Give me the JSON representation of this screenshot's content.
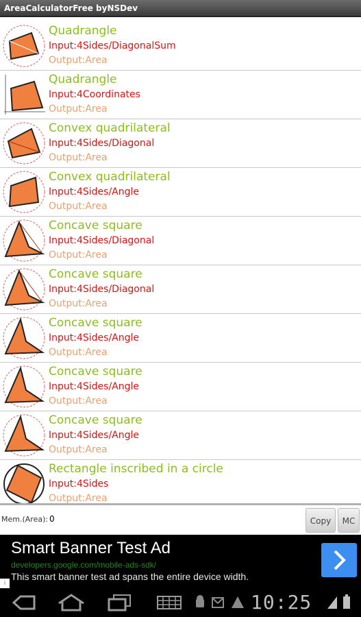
{
  "app": {
    "title": "AreaCalculatorFree byNSDev"
  },
  "items": [
    {
      "title": "Quadrangle",
      "input": "Input:4Sides/DiagonalSum",
      "output": "Output:Area",
      "icon": "quad-circle-icon"
    },
    {
      "title": "Quadrangle",
      "input": "Input:4Coordinates",
      "output": "Output:Area",
      "icon": "quad-coordinates-icon"
    },
    {
      "title": "Convex quadrilateral",
      "input": "Input:4Sides/Diagonal",
      "output": "Output:Area",
      "icon": "convex-diagonal-icon"
    },
    {
      "title": "Convex quadrilateral",
      "input": "Input:4Sides/Angle",
      "output": "Output:Area",
      "icon": "convex-angle-icon"
    },
    {
      "title": "Concave square",
      "input": "Input:4Sides/Diagonal",
      "output": "Output:Area",
      "icon": "concave-diagonal-icon"
    },
    {
      "title": "Concave square",
      "input": "Input:4Sides/Diagonal",
      "output": "Output:Area",
      "icon": "concave-diagonal-icon"
    },
    {
      "title": "Concave square",
      "input": "Input:4Sides/Angle",
      "output": "Output:Area",
      "icon": "concave-angle-icon"
    },
    {
      "title": "Concave square",
      "input": "Input:4Sides/Angle",
      "output": "Output:Area",
      "icon": "concave-angle-icon"
    },
    {
      "title": "Concave square",
      "input": "Input:4Sides/Angle",
      "output": "Output:Area",
      "icon": "concave-angle-icon"
    },
    {
      "title": "Rectangle inscribed in a circle",
      "input": "Input:4Sides",
      "output": "Output:Area",
      "icon": "inscribed-rectangle-icon"
    }
  ],
  "memory": {
    "label": "Mem.(Area):",
    "value": "0",
    "copy_label": "Copy",
    "mc_label": "MC"
  },
  "ad": {
    "title": "Smart Banner Test Ad",
    "url": "developers.google.com/mobile-ads-sdk/",
    "description": "This smart banner test ad spans the entire device width.",
    "info": "i"
  },
  "navbar": {
    "time": "10:25"
  },
  "colors": {
    "title": "#8abf1c",
    "input": "#e01010",
    "output": "#e8a070",
    "ad_button": "#3c8ef0"
  }
}
